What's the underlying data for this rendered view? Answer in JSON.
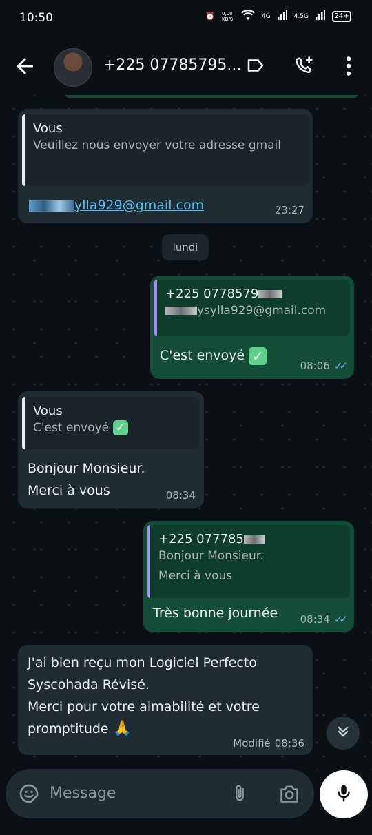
{
  "status_bar": {
    "time": "10:50",
    "net_speed": "0,00 KB/S",
    "network1": "4G",
    "network2": "4.5G",
    "battery": "24+"
  },
  "header": {
    "contact_name": "+225 07785795..."
  },
  "messages": {
    "m1": {
      "quote_name": "Vous",
      "quote_text": "Veuillez nous envoyer votre adresse gmail",
      "text_visible": "ylla929@gmail.com",
      "time": "23:27"
    },
    "day_chip": "lundi",
    "m2": {
      "quote_name": "+225 0778579",
      "quote_text": "ysylla929@gmail.com",
      "text": "C'est envoyé",
      "time": "08:06"
    },
    "m3": {
      "quote_name": "Vous",
      "quote_text": "C'est envoyé",
      "text_line1": "Bonjour Monsieur.",
      "text_line2": "Merci à vous",
      "time": "08:34"
    },
    "m4": {
      "quote_name": "+225 077785",
      "quote_line1": "Bonjour Monsieur.",
      "quote_line2": "Merci à vous",
      "text": "Très bonne journée",
      "time": "08:34"
    },
    "m5": {
      "line1": "J'ai bien reçu mon Logiciel Perfecto",
      "line2": "Syscohada Révisé.",
      "line3": "Merci pour votre aimabilité et votre",
      "line4": "promptitude",
      "edited_label": "Modifié",
      "time": "08:36"
    }
  },
  "input": {
    "placeholder": "Message"
  },
  "colors": {
    "incoming_bubble": "#1f2c33",
    "outgoing_bubble": "#144d37",
    "read_ticks": "#53bdeb",
    "quote_bar_self": "#e9edef",
    "quote_bar_contact": "#a78bfa"
  },
  "icons": [
    "back-arrow-icon",
    "label-icon",
    "add-call-icon",
    "more-vert-icon",
    "sticker-icon",
    "attach-icon",
    "camera-icon",
    "mic-icon",
    "double-chevron-down-icon",
    "check-emoji-icon",
    "pray-emoji-icon"
  ]
}
